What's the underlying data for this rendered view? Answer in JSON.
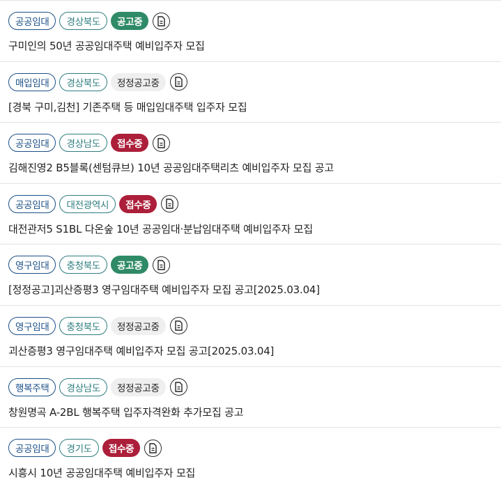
{
  "colors": {
    "type_tag": "#1b4f86",
    "region_tag": "#2f7d7e",
    "status_open": "#2f8a67",
    "status_receiving": "#ac1f3a",
    "status_corrected_bg": "#efefef"
  },
  "icons": {
    "document": "document-icon"
  },
  "notices": [
    {
      "type": "공공임대",
      "region": "경상북도",
      "status": "공고중",
      "status_kind": "open",
      "title": "구미인의 50년 공공임대주택 예비입주자 모집"
    },
    {
      "type": "매입임대",
      "region": "경상북도",
      "status": "정정공고중",
      "status_kind": "corrected",
      "title": "[경북 구미,김천] 기존주택 등 매입임대주택 입주자 모집"
    },
    {
      "type": "공공임대",
      "region": "경상남도",
      "status": "접수중",
      "status_kind": "receiving",
      "title": "김해진영2 B5블록(센텀큐브) 10년 공공임대주택리츠 예비입주자 모집 공고"
    },
    {
      "type": "공공임대",
      "region": "대전광역시",
      "status": "접수중",
      "status_kind": "receiving",
      "title": "대전관저5 S1BL 다온숲 10년 공공임대·분납임대주택 예비입주자 모집"
    },
    {
      "type": "영구임대",
      "region": "충청북도",
      "status": "공고중",
      "status_kind": "open",
      "title": "[정정공고]괴산증평3 영구임대주택 예비입주자 모집 공고[2025.03.04]"
    },
    {
      "type": "영구임대",
      "region": "충청북도",
      "status": "정정공고중",
      "status_kind": "corrected",
      "title": "괴산증평3 영구임대주택 예비입주자 모집 공고[2025.03.04]"
    },
    {
      "type": "행복주택",
      "region": "경상남도",
      "status": "정정공고중",
      "status_kind": "corrected",
      "title": "창원명곡 A-2BL 행복주택 입주자격완화 추가모집 공고"
    },
    {
      "type": "공공임대",
      "region": "경기도",
      "status": "접수중",
      "status_kind": "receiving",
      "title": "시흥시 10년 공공임대주택 예비입주자 모집"
    }
  ]
}
